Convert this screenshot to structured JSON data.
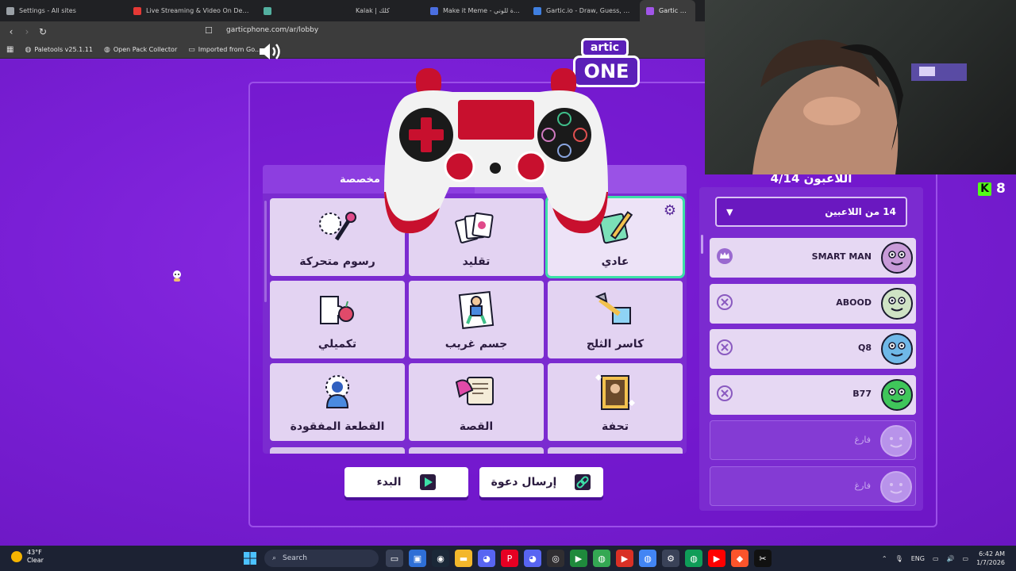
{
  "browser": {
    "tabs": [
      {
        "label": "Settings - All sites",
        "favicon_color": "#9aa0a6",
        "active": false
      },
      {
        "label": "Live Streaming & Video On Demand",
        "favicon_color": "#e53935",
        "active": false
      },
      {
        "label": "",
        "favicon_color": "#53b0a0",
        "active": false
      },
      {
        "label": "Kalak | كلك",
        "favicon_color": "#202124",
        "active": false
      },
      {
        "label": "Make it Meme - دعوة للوني",
        "favicon_color": "#4a6ee0",
        "active": false
      },
      {
        "label": "Gartic.io - Draw, Guess, WIN",
        "favicon_color": "#3f7fe0",
        "active": false
      },
      {
        "label": "Gartic Phone",
        "favicon_color": "#a155e8",
        "active": true
      }
    ],
    "url": "garticphone.com/ar/lobby",
    "bookmarks": [
      {
        "label": "Paletools v25.1.11"
      },
      {
        "label": "Open Pack Collector"
      },
      {
        "label": "Imported from Go..."
      }
    ]
  },
  "game": {
    "logo_top": "artic",
    "logo_bottom": "ONE",
    "mode_tabs": {
      "custom": "ات مخصصة",
      "settings": "الإعدا"
    },
    "modes": [
      {
        "label": "عادي",
        "icon": "normal-icon",
        "selected": true
      },
      {
        "label": "تقليد",
        "icon": "imitation-icon",
        "selected": false
      },
      {
        "label": "رسوم متحركة",
        "icon": "animation-icon",
        "selected": false
      },
      {
        "label": "كاسر الثلج",
        "icon": "icebreaker-icon",
        "selected": false
      },
      {
        "label": "جسم غريب",
        "icon": "exquisite-corpse-icon",
        "selected": false
      },
      {
        "label": "تكميلي",
        "icon": "complement-icon",
        "selected": false
      },
      {
        "label": "تحفة",
        "icon": "masterpiece-icon",
        "selected": false
      },
      {
        "label": "القصة",
        "icon": "story-icon",
        "selected": false
      },
      {
        "label": "القطعة المفقودة",
        "icon": "missing-piece-icon",
        "selected": false
      }
    ],
    "start_label": "البدء",
    "invite_label": "إرسال دعوة",
    "players_title": "اللاعبون 4/14",
    "players_dropdown": "14 من اللاعبين",
    "players": [
      {
        "name": "SMART MAN",
        "role": "host",
        "left_icon": "crown-icon",
        "avatar_color": "#c89ad8"
      },
      {
        "name": "ABOOD",
        "role": "player",
        "left_icon": "kick-icon",
        "avatar_color": "#cfe3c4"
      },
      {
        "name": "Q8",
        "role": "player",
        "left_icon": "kick-icon",
        "avatar_color": "#6fb8e8"
      },
      {
        "name": "B77",
        "role": "player",
        "left_icon": "kick-icon",
        "avatar_color": "#3fc65a"
      },
      {
        "name": "فارغ",
        "role": "empty",
        "left_icon": "",
        "avatar_color": "#b893ea"
      },
      {
        "name": "فارغ",
        "role": "empty",
        "left_icon": "",
        "avatar_color": "#b893ea"
      }
    ],
    "viewer_count": "8"
  },
  "taskbar": {
    "weather_temp": "43°F",
    "weather_desc": "Clear",
    "search_placeholder": "Search",
    "lang": "ENG",
    "time": "6:42 AM",
    "date": "1/7/2026"
  },
  "colors": {
    "page_bg": "#7a1fd6",
    "card_bg": "#e3d3f2",
    "selected_outline": "#3de0a8",
    "controller_red": "#c8102e"
  }
}
